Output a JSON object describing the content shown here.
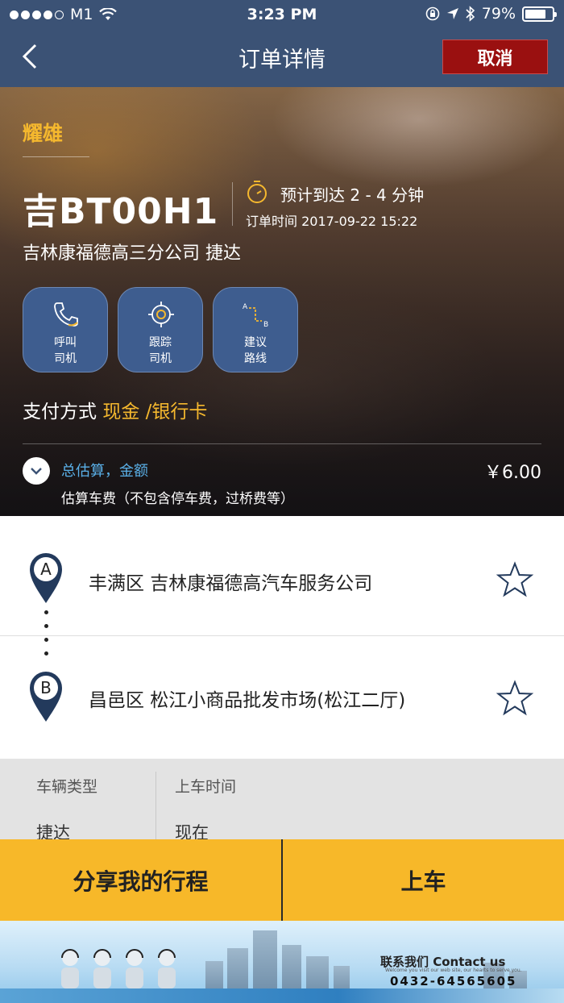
{
  "status_bar": {
    "carrier": "M1",
    "time": "3:23 PM",
    "battery": "79%",
    "battery_level": 0.79
  },
  "nav": {
    "title": "订单详情",
    "cancel_label": "取消"
  },
  "driver": {
    "name": "耀雄",
    "plate": "吉BT00H1",
    "eta": "预计到达 2 - 4 分钟",
    "order_time": "订单时间 2017-09-22 15:22",
    "company": "吉林康福德高三分公司 捷达"
  },
  "actions": [
    {
      "line1": "呼叫",
      "line2": "司机",
      "icon": "phone-icon"
    },
    {
      "line1": "跟踪",
      "line2": "司机",
      "icon": "locate-icon"
    },
    {
      "line1": "建议",
      "line2": "路线",
      "icon": "route-icon"
    }
  ],
  "payment": {
    "label": "支付方式",
    "value": "现金 /银行卡"
  },
  "fare": {
    "label": "总估算，金额",
    "value": "￥6.00",
    "note": "估算车费（不包含停车费，过桥费等）"
  },
  "locations": {
    "pickup": {
      "marker": "A",
      "address": "丰满区 吉林康福德高汽车服务公司"
    },
    "dropoff": {
      "marker": "B",
      "address": "昌邑区 松江小商品批发市场(松江二厅)"
    }
  },
  "info": {
    "vehicle_type_label": "车辆类型",
    "vehicle_type_value": "捷达",
    "pickup_time_label": "上车时间",
    "pickup_time_value": "现在"
  },
  "buttons": {
    "share": "分享我的行程",
    "board": "上车"
  },
  "banner": {
    "contact": "联系我们 Contact us",
    "subtitle": "Welcome you visit our web site, our hearts to serve you.",
    "phone": "0432-64565605"
  },
  "colors": {
    "nav": "#3b5275",
    "accent": "#f5b82e",
    "cancel": "#9a1010",
    "button": "#f7b829"
  }
}
